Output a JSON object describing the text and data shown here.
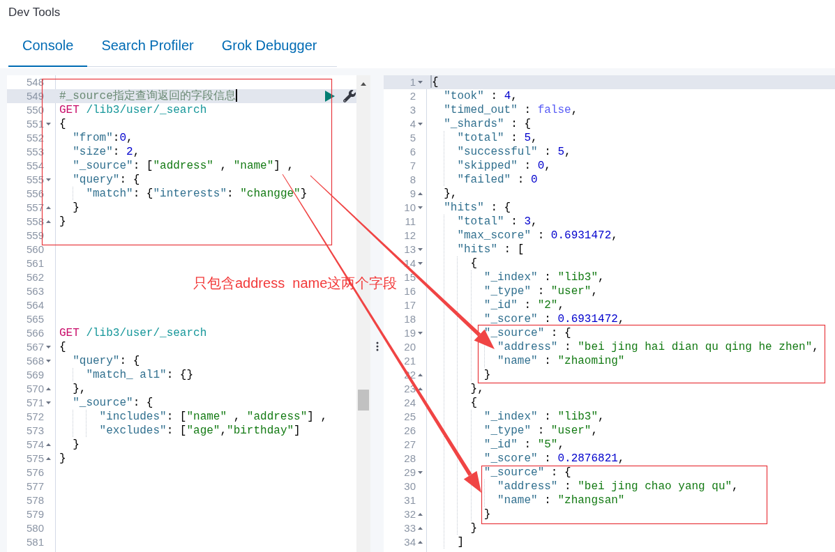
{
  "page": {
    "title": "Dev Tools"
  },
  "tabs": [
    {
      "label": "Console",
      "selected": true
    },
    {
      "label": "Search Profiler",
      "selected": false
    },
    {
      "label": "Grok Debugger",
      "selected": false
    }
  ],
  "request_editor": {
    "focused": true,
    "lines": [
      {
        "number": "548",
        "kind": "plain",
        "active": false
      },
      {
        "number": "549",
        "kind": "plain",
        "active": true,
        "tokens": [
          {
            "kind": "comment",
            "text": "#_source指定查询返回的字段信息"
          }
        ]
      },
      {
        "number": "550",
        "kind": "plain",
        "active": false,
        "tokens": [
          {
            "kind": "method",
            "text": "GET"
          },
          {
            "kind": "url",
            "text": " /lib3/user/_search"
          }
        ]
      },
      {
        "number": "551",
        "kind": "fold_open",
        "active": false,
        "tokens": [
          {
            "kind": "punct",
            "text": "{"
          }
        ]
      },
      {
        "number": "552",
        "kind": "plain",
        "active": false,
        "tokens": [
          {
            "kind": "key",
            "text": "  \"from\""
          },
          {
            "kind": "punct",
            "text": ":"
          },
          {
            "kind": "number",
            "text": "0"
          },
          {
            "kind": "punct",
            "text": ","
          }
        ]
      },
      {
        "number": "553",
        "kind": "plain",
        "active": false,
        "tokens": [
          {
            "kind": "key",
            "text": "  \"size\""
          },
          {
            "kind": "punct",
            "text": ": "
          },
          {
            "kind": "number",
            "text": "2"
          },
          {
            "kind": "punct",
            "text": ","
          }
        ]
      },
      {
        "number": "554",
        "kind": "plain",
        "active": false,
        "tokens": [
          {
            "kind": "key",
            "text": "  \"_source\""
          },
          {
            "kind": "punct",
            "text": ": ["
          },
          {
            "kind": "string",
            "text": "\"address\""
          },
          {
            "kind": "punct",
            "text": " , "
          },
          {
            "kind": "string",
            "text": "\"name\""
          },
          {
            "kind": "punct",
            "text": "] ,"
          }
        ]
      },
      {
        "number": "555",
        "kind": "fold_open",
        "active": false,
        "tokens": [
          {
            "kind": "key",
            "text": "  \"query\""
          },
          {
            "kind": "punct",
            "text": ": {"
          }
        ]
      },
      {
        "number": "556",
        "kind": "plain",
        "active": false,
        "tokens": [
          {
            "kind": "key",
            "text": "    \"match\""
          },
          {
            "kind": "punct",
            "text": ": {"
          },
          {
            "kind": "key",
            "text": "\"interests\""
          },
          {
            "kind": "punct",
            "text": ": "
          },
          {
            "kind": "string",
            "text": "\"changge\""
          },
          {
            "kind": "punct",
            "text": "}"
          }
        ]
      },
      {
        "number": "557",
        "kind": "fold_close",
        "active": false,
        "tokens": [
          {
            "kind": "punct",
            "text": "  }"
          }
        ]
      },
      {
        "number": "558",
        "kind": "fold_close",
        "active": false,
        "tokens": [
          {
            "kind": "punct",
            "text": "}"
          }
        ]
      },
      {
        "number": "559",
        "kind": "plain",
        "active": false
      },
      {
        "number": "560",
        "kind": "plain",
        "active": false
      },
      {
        "number": "561",
        "kind": "plain",
        "active": false
      },
      {
        "number": "562",
        "kind": "plain",
        "active": false
      },
      {
        "number": "563",
        "kind": "plain",
        "active": false
      },
      {
        "number": "564",
        "kind": "plain",
        "active": false
      },
      {
        "number": "565",
        "kind": "plain",
        "active": false
      },
      {
        "number": "566",
        "kind": "plain",
        "active": false,
        "tokens": [
          {
            "kind": "method",
            "text": "GET"
          },
          {
            "kind": "url",
            "text": " /lib3/user/_search"
          }
        ]
      },
      {
        "number": "567",
        "kind": "fold_open",
        "active": false,
        "tokens": [
          {
            "kind": "punct",
            "text": "{"
          }
        ]
      },
      {
        "number": "568",
        "kind": "fold_open",
        "active": false,
        "tokens": [
          {
            "kind": "key",
            "text": "  \"query\""
          },
          {
            "kind": "punct",
            "text": ": {"
          }
        ]
      },
      {
        "number": "569",
        "kind": "plain",
        "active": false,
        "tokens": [
          {
            "kind": "key",
            "text": "    \"match_ al1\""
          },
          {
            "kind": "punct",
            "text": ": {}"
          }
        ]
      },
      {
        "number": "570",
        "kind": "fold_close",
        "active": false,
        "tokens": [
          {
            "kind": "punct",
            "text": "  },"
          }
        ]
      },
      {
        "number": "571",
        "kind": "fold_open",
        "active": false,
        "tokens": [
          {
            "kind": "key",
            "text": "  \"_source\""
          },
          {
            "kind": "punct",
            "text": ": {"
          }
        ]
      },
      {
        "number": "572",
        "kind": "plain",
        "active": false,
        "tokens": [
          {
            "kind": "key",
            "text": "      \"includes\""
          },
          {
            "kind": "punct",
            "text": ": ["
          },
          {
            "kind": "string",
            "text": "\"name\""
          },
          {
            "kind": "punct",
            "text": " , "
          },
          {
            "kind": "string",
            "text": "\"address\""
          },
          {
            "kind": "punct",
            "text": "] ,"
          }
        ]
      },
      {
        "number": "573",
        "kind": "plain",
        "active": false,
        "tokens": [
          {
            "kind": "key",
            "text": "      \"excludes\""
          },
          {
            "kind": "punct",
            "text": ": ["
          },
          {
            "kind": "string",
            "text": "\"age\""
          },
          {
            "kind": "punct",
            "text": ","
          },
          {
            "kind": "string",
            "text": "\"birthday\""
          },
          {
            "kind": "punct",
            "text": "]"
          }
        ]
      },
      {
        "number": "574",
        "kind": "fold_close",
        "active": false,
        "tokens": [
          {
            "kind": "punct",
            "text": "  }"
          }
        ]
      },
      {
        "number": "575",
        "kind": "fold_close",
        "active": false,
        "tokens": [
          {
            "kind": "punct",
            "text": "}"
          }
        ]
      },
      {
        "number": "576",
        "kind": "plain",
        "active": false
      },
      {
        "number": "577",
        "kind": "plain",
        "active": false
      },
      {
        "number": "578",
        "kind": "plain",
        "active": false
      },
      {
        "number": "579",
        "kind": "plain",
        "active": false
      },
      {
        "number": "580",
        "kind": "plain",
        "active": false
      },
      {
        "number": "581",
        "kind": "plain",
        "active": false
      }
    ]
  },
  "response_editor": {
    "focused": false,
    "lines": [
      {
        "number": "1",
        "kind": "fold_open",
        "active": true,
        "tokens": [
          {
            "kind": "punct",
            "text": "{"
          }
        ]
      },
      {
        "number": "2",
        "kind": "plain",
        "active": false,
        "tokens": [
          {
            "kind": "key",
            "text": "  \"took\""
          },
          {
            "kind": "punct",
            "text": " : "
          },
          {
            "kind": "number",
            "text": "4"
          },
          {
            "kind": "punct",
            "text": ","
          }
        ]
      },
      {
        "number": "3",
        "kind": "plain",
        "active": false,
        "tokens": [
          {
            "kind": "key",
            "text": "  \"timed_out\""
          },
          {
            "kind": "punct",
            "text": " : "
          },
          {
            "kind": "boolean",
            "text": "false"
          },
          {
            "kind": "punct",
            "text": ","
          }
        ]
      },
      {
        "number": "4",
        "kind": "fold_open",
        "active": false,
        "tokens": [
          {
            "kind": "key",
            "text": "  \"_shards\""
          },
          {
            "kind": "punct",
            "text": " : {"
          }
        ]
      },
      {
        "number": "5",
        "kind": "plain",
        "active": false,
        "tokens": [
          {
            "kind": "key",
            "text": "    \"total\""
          },
          {
            "kind": "punct",
            "text": " : "
          },
          {
            "kind": "number",
            "text": "5"
          },
          {
            "kind": "punct",
            "text": ","
          }
        ]
      },
      {
        "number": "6",
        "kind": "plain",
        "active": false,
        "tokens": [
          {
            "kind": "key",
            "text": "    \"successful\""
          },
          {
            "kind": "punct",
            "text": " : "
          },
          {
            "kind": "number",
            "text": "5"
          },
          {
            "kind": "punct",
            "text": ","
          }
        ]
      },
      {
        "number": "7",
        "kind": "plain",
        "active": false,
        "tokens": [
          {
            "kind": "key",
            "text": "    \"skipped\""
          },
          {
            "kind": "punct",
            "text": " : "
          },
          {
            "kind": "number",
            "text": "0"
          },
          {
            "kind": "punct",
            "text": ","
          }
        ]
      },
      {
        "number": "8",
        "kind": "plain",
        "active": false,
        "tokens": [
          {
            "kind": "key",
            "text": "    \"failed\""
          },
          {
            "kind": "punct",
            "text": " : "
          },
          {
            "kind": "number",
            "text": "0"
          }
        ]
      },
      {
        "number": "9",
        "kind": "fold_close",
        "active": false,
        "tokens": [
          {
            "kind": "punct",
            "text": "  },"
          }
        ]
      },
      {
        "number": "10",
        "kind": "fold_open",
        "active": false,
        "tokens": [
          {
            "kind": "key",
            "text": "  \"hits\""
          },
          {
            "kind": "punct",
            "text": " : {"
          }
        ]
      },
      {
        "number": "11",
        "kind": "plain",
        "active": false,
        "tokens": [
          {
            "kind": "key",
            "text": "    \"total\""
          },
          {
            "kind": "punct",
            "text": " : "
          },
          {
            "kind": "number",
            "text": "3"
          },
          {
            "kind": "punct",
            "text": ","
          }
        ]
      },
      {
        "number": "12",
        "kind": "plain",
        "active": false,
        "tokens": [
          {
            "kind": "key",
            "text": "    \"max_score\""
          },
          {
            "kind": "punct",
            "text": " : "
          },
          {
            "kind": "number",
            "text": "0.6931472"
          },
          {
            "kind": "punct",
            "text": ","
          }
        ]
      },
      {
        "number": "13",
        "kind": "fold_open",
        "active": false,
        "tokens": [
          {
            "kind": "key",
            "text": "    \"hits\""
          },
          {
            "kind": "punct",
            "text": " : ["
          }
        ]
      },
      {
        "number": "14",
        "kind": "fold_open",
        "active": false,
        "tokens": [
          {
            "kind": "punct",
            "text": "      {"
          }
        ]
      },
      {
        "number": "15",
        "kind": "plain",
        "active": false,
        "tokens": [
          {
            "kind": "key",
            "text": "        \"_index\""
          },
          {
            "kind": "punct",
            "text": " : "
          },
          {
            "kind": "string",
            "text": "\"lib3\""
          },
          {
            "kind": "punct",
            "text": ","
          }
        ]
      },
      {
        "number": "16",
        "kind": "plain",
        "active": false,
        "tokens": [
          {
            "kind": "key",
            "text": "        \"_type\""
          },
          {
            "kind": "punct",
            "text": " : "
          },
          {
            "kind": "string",
            "text": "\"user\""
          },
          {
            "kind": "punct",
            "text": ","
          }
        ]
      },
      {
        "number": "17",
        "kind": "plain",
        "active": false,
        "tokens": [
          {
            "kind": "key",
            "text": "        \"_id\""
          },
          {
            "kind": "punct",
            "text": " : "
          },
          {
            "kind": "string",
            "text": "\"2\""
          },
          {
            "kind": "punct",
            "text": ","
          }
        ]
      },
      {
        "number": "18",
        "kind": "plain",
        "active": false,
        "tokens": [
          {
            "kind": "key",
            "text": "        \"_score\""
          },
          {
            "kind": "punct",
            "text": " : "
          },
          {
            "kind": "number",
            "text": "0.6931472"
          },
          {
            "kind": "punct",
            "text": ","
          }
        ]
      },
      {
        "number": "19",
        "kind": "fold_open",
        "active": false,
        "tokens": [
          {
            "kind": "key",
            "text": "        \"_source\""
          },
          {
            "kind": "punct",
            "text": " : {"
          }
        ]
      },
      {
        "number": "20",
        "kind": "plain",
        "active": false,
        "tokens": [
          {
            "kind": "key",
            "text": "          \"address\""
          },
          {
            "kind": "punct",
            "text": " : "
          },
          {
            "kind": "string",
            "text": "\"bei jing hai dian qu qing he zhen\""
          },
          {
            "kind": "punct",
            "text": ","
          }
        ]
      },
      {
        "number": "21",
        "kind": "plain",
        "active": false,
        "tokens": [
          {
            "kind": "key",
            "text": "          \"name\""
          },
          {
            "kind": "punct",
            "text": " : "
          },
          {
            "kind": "string",
            "text": "\"zhaoming\""
          }
        ]
      },
      {
        "number": "22",
        "kind": "fold_close",
        "active": false,
        "tokens": [
          {
            "kind": "punct",
            "text": "        }"
          }
        ]
      },
      {
        "number": "23",
        "kind": "fold_close",
        "active": false,
        "tokens": [
          {
            "kind": "punct",
            "text": "      },"
          }
        ]
      },
      {
        "number": "24",
        "kind": "plain",
        "active": false,
        "tokens": [
          {
            "kind": "punct",
            "text": "      {"
          }
        ]
      },
      {
        "number": "25",
        "kind": "plain",
        "active": false,
        "tokens": [
          {
            "kind": "key",
            "text": "        \"_index\""
          },
          {
            "kind": "punct",
            "text": " : "
          },
          {
            "kind": "string",
            "text": "\"lib3\""
          },
          {
            "kind": "punct",
            "text": ","
          }
        ]
      },
      {
        "number": "26",
        "kind": "plain",
        "active": false,
        "tokens": [
          {
            "kind": "key",
            "text": "        \"_type\""
          },
          {
            "kind": "punct",
            "text": " : "
          },
          {
            "kind": "string",
            "text": "\"user\""
          },
          {
            "kind": "punct",
            "text": ","
          }
        ]
      },
      {
        "number": "27",
        "kind": "plain",
        "active": false,
        "tokens": [
          {
            "kind": "key",
            "text": "        \"_id\""
          },
          {
            "kind": "punct",
            "text": " : "
          },
          {
            "kind": "string",
            "text": "\"5\""
          },
          {
            "kind": "punct",
            "text": ","
          }
        ]
      },
      {
        "number": "28",
        "kind": "plain",
        "active": false,
        "tokens": [
          {
            "kind": "key",
            "text": "        \"_score\""
          },
          {
            "kind": "punct",
            "text": " : "
          },
          {
            "kind": "number",
            "text": "0.2876821"
          },
          {
            "kind": "punct",
            "text": ","
          }
        ]
      },
      {
        "number": "29",
        "kind": "fold_open",
        "active": false,
        "tokens": [
          {
            "kind": "key",
            "text": "        \"_source\""
          },
          {
            "kind": "punct",
            "text": " : {"
          }
        ]
      },
      {
        "number": "30",
        "kind": "plain",
        "active": false,
        "tokens": [
          {
            "kind": "key",
            "text": "          \"address\""
          },
          {
            "kind": "punct",
            "text": " : "
          },
          {
            "kind": "string",
            "text": "\"bei jing chao yang qu\""
          },
          {
            "kind": "punct",
            "text": ","
          }
        ]
      },
      {
        "number": "31",
        "kind": "plain",
        "active": false,
        "tokens": [
          {
            "kind": "key",
            "text": "          \"name\""
          },
          {
            "kind": "punct",
            "text": " : "
          },
          {
            "kind": "string",
            "text": "\"zhangsan\""
          }
        ]
      },
      {
        "number": "32",
        "kind": "fold_close",
        "active": false,
        "tokens": [
          {
            "kind": "punct",
            "text": "        }"
          }
        ]
      },
      {
        "number": "33",
        "kind": "fold_close",
        "active": false,
        "tokens": [
          {
            "kind": "punct",
            "text": "      }"
          }
        ]
      },
      {
        "number": "34",
        "kind": "fold_close",
        "active": false,
        "tokens": [
          {
            "kind": "punct",
            "text": "    ]"
          }
        ]
      }
    ]
  },
  "annotation": {
    "note": "只包含address  name这两个字段"
  }
}
